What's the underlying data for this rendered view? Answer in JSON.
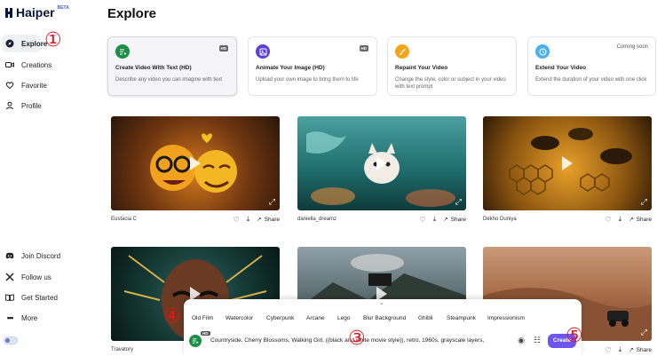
{
  "brand": {
    "name": "Haiper",
    "beta": "BETA"
  },
  "sidebar": {
    "items": [
      {
        "label": "Explore",
        "icon": "compass-icon"
      },
      {
        "label": "Creations",
        "icon": "video-icon"
      },
      {
        "label": "Favorite",
        "icon": "heart-icon"
      },
      {
        "label": "Profile",
        "icon": "person-icon"
      }
    ],
    "bottom": [
      {
        "label": "Join Discord",
        "icon": "discord-icon"
      },
      {
        "label": "Follow us",
        "icon": "x-icon"
      },
      {
        "label": "Get Started",
        "icon": "book-icon"
      },
      {
        "label": "More",
        "icon": "dots-icon"
      }
    ]
  },
  "page": {
    "title": "Explore"
  },
  "features": [
    {
      "title": "Create Video With Text (HD)",
      "desc": "Describe any video you can imagine with text",
      "badge": "HD",
      "color": "#1b8f47"
    },
    {
      "title": "Animate Your Image (HD)",
      "desc": "Upload your own image to bring them to life",
      "badge": "HD",
      "color": "#5b3fd6"
    },
    {
      "title": "Repaint Your Video",
      "desc": "Change the style, color or subject in your video with text prompt",
      "badge": "",
      "color": "#f2a516"
    },
    {
      "title": "Extend Your Video",
      "desc": "Extend the duration of your video with one click",
      "badge": "Coming soon",
      "color": "#4ab0f0"
    }
  ],
  "videos": [
    {
      "author": "Eustacia C",
      "share": "Share"
    },
    {
      "author": "daniella_dreamz",
      "share": "Share"
    },
    {
      "author": "Dekho Duniya",
      "share": "Share"
    },
    {
      "author": "Travatory",
      "share": "Share"
    },
    {
      "author": "",
      "share": "Share"
    },
    {
      "author": "",
      "share": "Share"
    }
  ],
  "styles": [
    "Old Film",
    "Watercolor",
    "Cyberpunk",
    "Arcane",
    "Lego",
    "Blur Background",
    "Ghibli",
    "Steampunk",
    "Impressionism"
  ],
  "prompt": {
    "badge": "HD",
    "text": "Countryside, Cherry Blossoms, Walking Girl, ((black and white movie style)), retro, 1960s, grayscale layers,",
    "create_label": "Create"
  },
  "annotations": [
    "①",
    "②",
    "③",
    "④",
    "⑤"
  ]
}
